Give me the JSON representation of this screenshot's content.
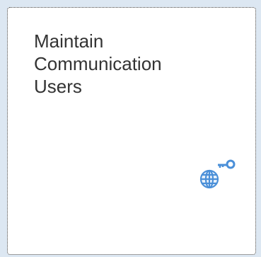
{
  "tile": {
    "title_lines": [
      "Maintain",
      "Communication",
      "Users"
    ],
    "icon": "globe-with-key-icon",
    "icon_color": "#4a8fd8"
  }
}
